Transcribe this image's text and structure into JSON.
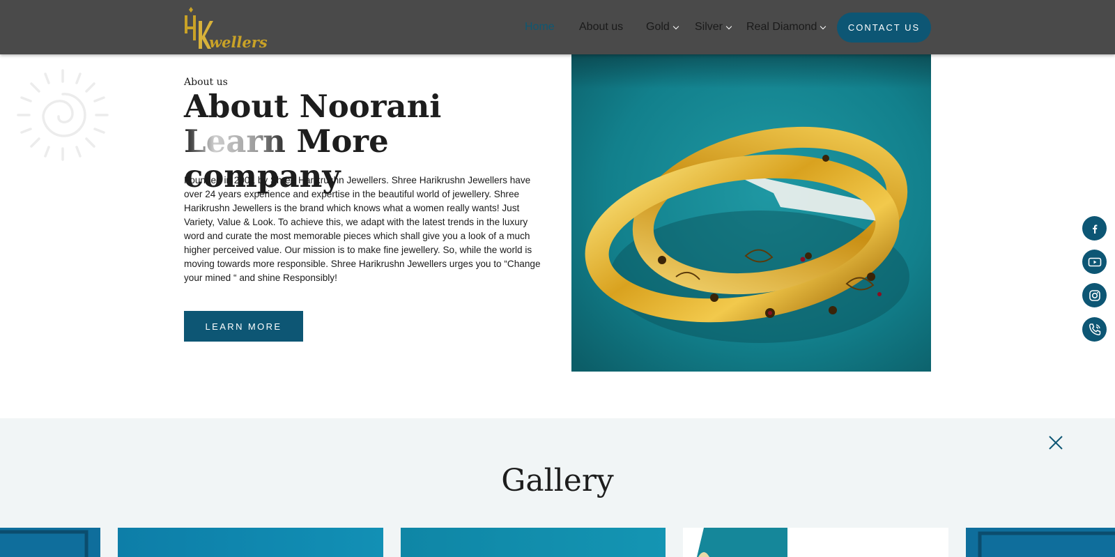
{
  "brand": {
    "logo_text": "wellers",
    "logo_monogram": "HK"
  },
  "nav": {
    "items": [
      {
        "label": "Home",
        "active": true,
        "dropdown": false
      },
      {
        "label": "About us",
        "active": false,
        "dropdown": false
      },
      {
        "label": "Gold",
        "active": false,
        "dropdown": true
      },
      {
        "label": "Silver",
        "active": false,
        "dropdown": true
      },
      {
        "label": "Real Diamond",
        "active": false,
        "dropdown": true
      }
    ],
    "contact_label": "CONTACT US"
  },
  "about": {
    "eyebrow": "About us",
    "heading_part1": "About Noorani ",
    "heading_part2": "Learn",
    "heading_part3": "More company",
    "body": "Founded in 2001 by Shree Harikrushn Jewellers. Shree Harikrushn Jewellers have over 24 years experience and expertise in the beautiful world of jewellery. Shree Harikrushn Jewellers is the brand which knows what a women really wants! Just Variety, Value & Look. To achieve this, we adapt with the latest trends in the luxury word and curate the most memorable pieces which shall give you a look of a much higher perceived value. Our mission is to make fine jewellery. So, while the world is moving towards more responsible. Shree Harikrushn Jewellers urges you to “Change your mined “ and shine Responsibly!",
    "button_label": "LEARN MORE"
  },
  "social": [
    {
      "name": "facebook-icon"
    },
    {
      "name": "youtube-icon"
    },
    {
      "name": "instagram-icon"
    },
    {
      "name": "phone-icon"
    }
  ],
  "gallery": {
    "title": "Gallery"
  },
  "colors": {
    "header_bg": "#4a4a4a",
    "accent": "#0d5674",
    "gold": "#c9a227",
    "gallery_bg": "#f1f5f6"
  }
}
